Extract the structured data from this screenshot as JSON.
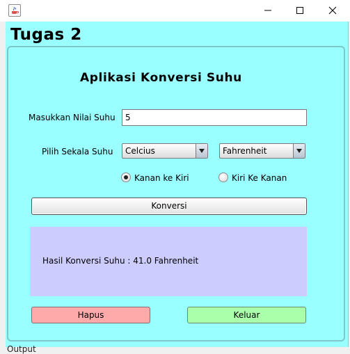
{
  "window": {
    "heading": "Tugas 2",
    "output_label": "Output"
  },
  "app": {
    "title": "Aplikasi Konversi Suhu",
    "input_label": "Masukkan Nilai Suhu",
    "input_value": "5",
    "scale_label": "Pilih Sekala Suhu",
    "from_scale": "Celcius",
    "to_scale": "Fahrenheit",
    "radio_right_to_left": "Kanan ke Kiri",
    "radio_left_to_right": "Kiri Ke Kanan",
    "selected_direction": "Kanan ke Kiri",
    "convert_button": "Konversi",
    "result_text": "Hasil Konversi Suhu : 41.0 Fahrenheit",
    "clear_button": "Hapus",
    "exit_button": "Keluar"
  },
  "colors": {
    "frame_background": "#99ffff",
    "result_background": "#ccccff",
    "clear_button": "#ffaaaa",
    "exit_button": "#aaffaa"
  },
  "icons": {
    "app_icon": "java-coffee-cup-icon",
    "minimize": "minimize-icon",
    "maximize": "maximize-icon",
    "close": "close-icon"
  }
}
